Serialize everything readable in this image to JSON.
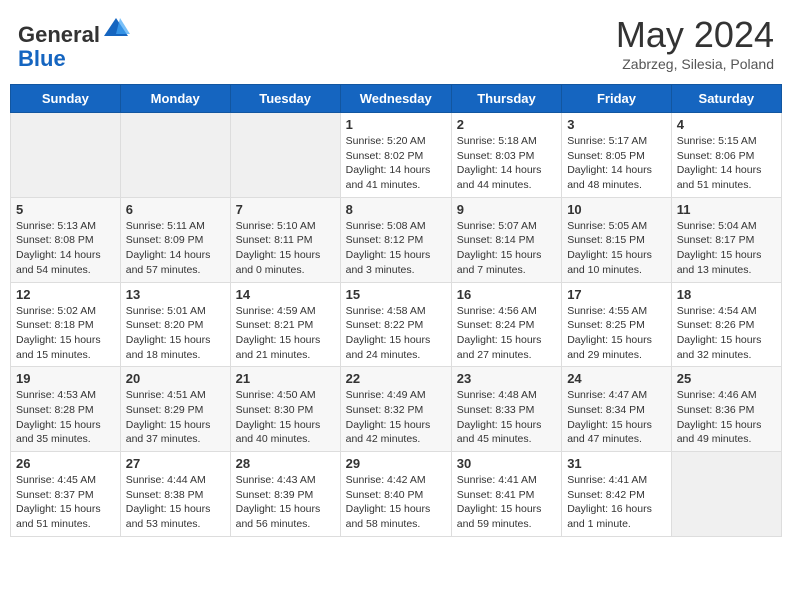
{
  "header": {
    "logo_general": "General",
    "logo_blue": "Blue",
    "month_title": "May 2024",
    "subtitle": "Zabrzeg, Silesia, Poland"
  },
  "days_of_week": [
    "Sunday",
    "Monday",
    "Tuesday",
    "Wednesday",
    "Thursday",
    "Friday",
    "Saturday"
  ],
  "weeks": [
    [
      {
        "day": "",
        "info": ""
      },
      {
        "day": "",
        "info": ""
      },
      {
        "day": "",
        "info": ""
      },
      {
        "day": "1",
        "info": "Sunrise: 5:20 AM\nSunset: 8:02 PM\nDaylight: 14 hours and 41 minutes."
      },
      {
        "day": "2",
        "info": "Sunrise: 5:18 AM\nSunset: 8:03 PM\nDaylight: 14 hours and 44 minutes."
      },
      {
        "day": "3",
        "info": "Sunrise: 5:17 AM\nSunset: 8:05 PM\nDaylight: 14 hours and 48 minutes."
      },
      {
        "day": "4",
        "info": "Sunrise: 5:15 AM\nSunset: 8:06 PM\nDaylight: 14 hours and 51 minutes."
      }
    ],
    [
      {
        "day": "5",
        "info": "Sunrise: 5:13 AM\nSunset: 8:08 PM\nDaylight: 14 hours and 54 minutes."
      },
      {
        "day": "6",
        "info": "Sunrise: 5:11 AM\nSunset: 8:09 PM\nDaylight: 14 hours and 57 minutes."
      },
      {
        "day": "7",
        "info": "Sunrise: 5:10 AM\nSunset: 8:11 PM\nDaylight: 15 hours and 0 minutes."
      },
      {
        "day": "8",
        "info": "Sunrise: 5:08 AM\nSunset: 8:12 PM\nDaylight: 15 hours and 3 minutes."
      },
      {
        "day": "9",
        "info": "Sunrise: 5:07 AM\nSunset: 8:14 PM\nDaylight: 15 hours and 7 minutes."
      },
      {
        "day": "10",
        "info": "Sunrise: 5:05 AM\nSunset: 8:15 PM\nDaylight: 15 hours and 10 minutes."
      },
      {
        "day": "11",
        "info": "Sunrise: 5:04 AM\nSunset: 8:17 PM\nDaylight: 15 hours and 13 minutes."
      }
    ],
    [
      {
        "day": "12",
        "info": "Sunrise: 5:02 AM\nSunset: 8:18 PM\nDaylight: 15 hours and 15 minutes."
      },
      {
        "day": "13",
        "info": "Sunrise: 5:01 AM\nSunset: 8:20 PM\nDaylight: 15 hours and 18 minutes."
      },
      {
        "day": "14",
        "info": "Sunrise: 4:59 AM\nSunset: 8:21 PM\nDaylight: 15 hours and 21 minutes."
      },
      {
        "day": "15",
        "info": "Sunrise: 4:58 AM\nSunset: 8:22 PM\nDaylight: 15 hours and 24 minutes."
      },
      {
        "day": "16",
        "info": "Sunrise: 4:56 AM\nSunset: 8:24 PM\nDaylight: 15 hours and 27 minutes."
      },
      {
        "day": "17",
        "info": "Sunrise: 4:55 AM\nSunset: 8:25 PM\nDaylight: 15 hours and 29 minutes."
      },
      {
        "day": "18",
        "info": "Sunrise: 4:54 AM\nSunset: 8:26 PM\nDaylight: 15 hours and 32 minutes."
      }
    ],
    [
      {
        "day": "19",
        "info": "Sunrise: 4:53 AM\nSunset: 8:28 PM\nDaylight: 15 hours and 35 minutes."
      },
      {
        "day": "20",
        "info": "Sunrise: 4:51 AM\nSunset: 8:29 PM\nDaylight: 15 hours and 37 minutes."
      },
      {
        "day": "21",
        "info": "Sunrise: 4:50 AM\nSunset: 8:30 PM\nDaylight: 15 hours and 40 minutes."
      },
      {
        "day": "22",
        "info": "Sunrise: 4:49 AM\nSunset: 8:32 PM\nDaylight: 15 hours and 42 minutes."
      },
      {
        "day": "23",
        "info": "Sunrise: 4:48 AM\nSunset: 8:33 PM\nDaylight: 15 hours and 45 minutes."
      },
      {
        "day": "24",
        "info": "Sunrise: 4:47 AM\nSunset: 8:34 PM\nDaylight: 15 hours and 47 minutes."
      },
      {
        "day": "25",
        "info": "Sunrise: 4:46 AM\nSunset: 8:36 PM\nDaylight: 15 hours and 49 minutes."
      }
    ],
    [
      {
        "day": "26",
        "info": "Sunrise: 4:45 AM\nSunset: 8:37 PM\nDaylight: 15 hours and 51 minutes."
      },
      {
        "day": "27",
        "info": "Sunrise: 4:44 AM\nSunset: 8:38 PM\nDaylight: 15 hours and 53 minutes."
      },
      {
        "day": "28",
        "info": "Sunrise: 4:43 AM\nSunset: 8:39 PM\nDaylight: 15 hours and 56 minutes."
      },
      {
        "day": "29",
        "info": "Sunrise: 4:42 AM\nSunset: 8:40 PM\nDaylight: 15 hours and 58 minutes."
      },
      {
        "day": "30",
        "info": "Sunrise: 4:41 AM\nSunset: 8:41 PM\nDaylight: 15 hours and 59 minutes."
      },
      {
        "day": "31",
        "info": "Sunrise: 4:41 AM\nSunset: 8:42 PM\nDaylight: 16 hours and 1 minute."
      },
      {
        "day": "",
        "info": ""
      }
    ]
  ]
}
